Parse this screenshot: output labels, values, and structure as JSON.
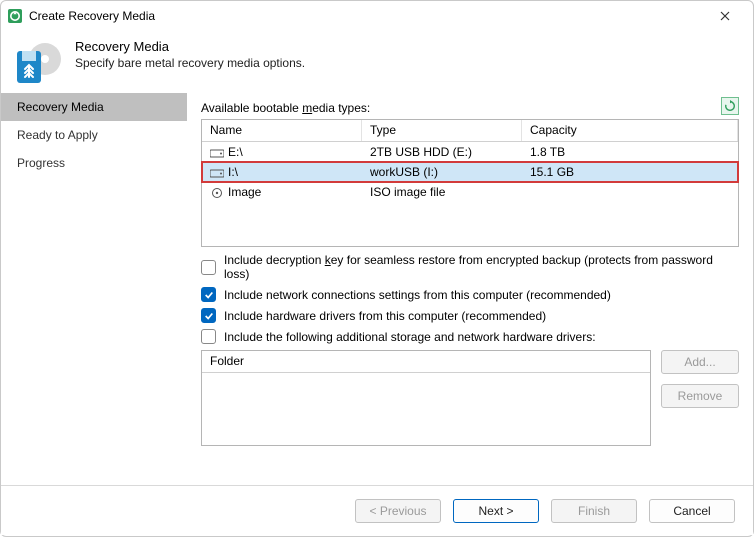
{
  "window": {
    "title": "Create Recovery Media"
  },
  "header": {
    "title": "Recovery Media",
    "subtitle": "Specify bare metal recovery media options."
  },
  "sidebar": {
    "items": [
      {
        "label": "Recovery Media",
        "active": true
      },
      {
        "label": "Ready to Apply",
        "active": false
      },
      {
        "label": "Progress",
        "active": false
      }
    ]
  },
  "main": {
    "available_label_pre": "Available bootable ",
    "available_label_u": "m",
    "available_label_post": "edia types:",
    "columns": {
      "name": "Name",
      "type": "Type",
      "capacity": "Capacity"
    },
    "rows": [
      {
        "name": "E:\\",
        "type": "2TB USB HDD (E:)",
        "capacity": "1.8 TB",
        "selected": false,
        "icon": "drive"
      },
      {
        "name": "I:\\",
        "type": "workUSB (I:)",
        "capacity": "15.1 GB",
        "selected": true,
        "icon": "drive"
      },
      {
        "name": "Image",
        "type": "ISO image file",
        "capacity": "",
        "selected": false,
        "icon": "iso"
      }
    ],
    "checks": {
      "decrypt_pre": "Include decryption ",
      "decrypt_u": "k",
      "decrypt_post": "ey for seamless restore from encrypted backup (protects from password loss)",
      "decrypt_checked": false,
      "network": "Include network connections settings from this computer (recommended)",
      "network_checked": true,
      "drivers": "Include hardware drivers from this computer (recommended)",
      "drivers_checked": true,
      "additional": "Include the following additional storage and network hardware drivers:",
      "additional_checked": false
    },
    "folder_header": "Folder",
    "buttons": {
      "add_u": "A",
      "add_post": "dd...",
      "remove_u": "R",
      "remove_post": "emove"
    }
  },
  "footer": {
    "previous": "< Previous",
    "next": "Next >",
    "finish_u": "F",
    "finish_post": "inish",
    "cancel": "Cancel"
  },
  "colors": {
    "accent": "#0067c0",
    "select_bg": "#cfe6f7",
    "select_outline": "#d23b3b"
  }
}
